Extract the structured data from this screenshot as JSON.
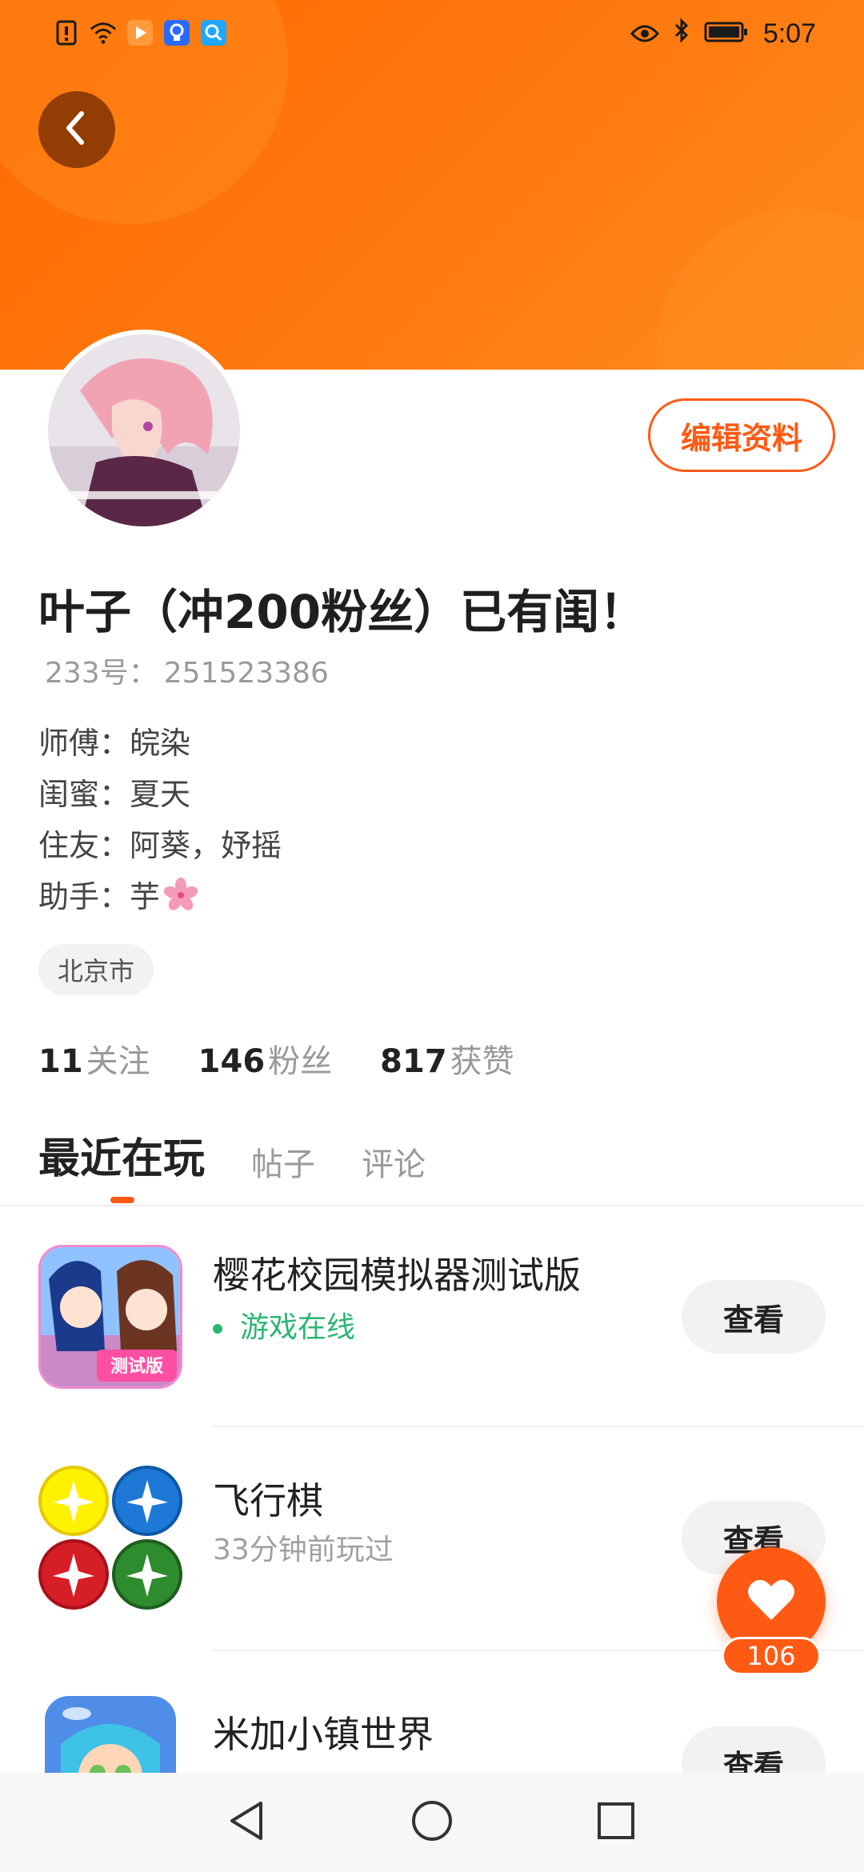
{
  "status_bar": {
    "time": "5:07",
    "icons": [
      "alert-icon",
      "wifi-icon",
      "video-app-icon",
      "bulb-app-icon",
      "search-app-icon",
      "eye-icon",
      "bluetooth-icon",
      "battery-icon"
    ]
  },
  "colors": {
    "accent": "#ff5a14",
    "banner": "#ff7a10",
    "online_green": "#2bb673"
  },
  "profile": {
    "edit_label": "编辑资料",
    "name": "叶子（冲200粉丝）已有闺！",
    "uid_label": "233号：",
    "uid_value": "251523386",
    "relations": [
      {
        "label": "师傅：",
        "value": "皖染"
      },
      {
        "label": "闺蜜：",
        "value": "夏天"
      },
      {
        "label": "住友：",
        "value": "阿葵，妤摇"
      },
      {
        "label": "助手：",
        "value": "芋"
      }
    ],
    "city": "北京市",
    "stats": [
      {
        "num": "11",
        "label": "关注"
      },
      {
        "num": "146",
        "label": "粉丝"
      },
      {
        "num": "817",
        "label": "获赞"
      }
    ]
  },
  "tabs": [
    {
      "label": "最近在玩",
      "active": true
    },
    {
      "label": "帖子",
      "active": false
    },
    {
      "label": "评论",
      "active": false
    }
  ],
  "games": [
    {
      "title": "樱花校园模拟器测试版",
      "sub": "游戏在线",
      "button": "查看",
      "icon_badge": "测试版"
    },
    {
      "title": "飞行棋",
      "sub": "33分钟前玩过",
      "button": "查看"
    },
    {
      "title": "米加小镇世界",
      "sub": "",
      "button": "查看"
    }
  ],
  "like": {
    "count": "106"
  }
}
